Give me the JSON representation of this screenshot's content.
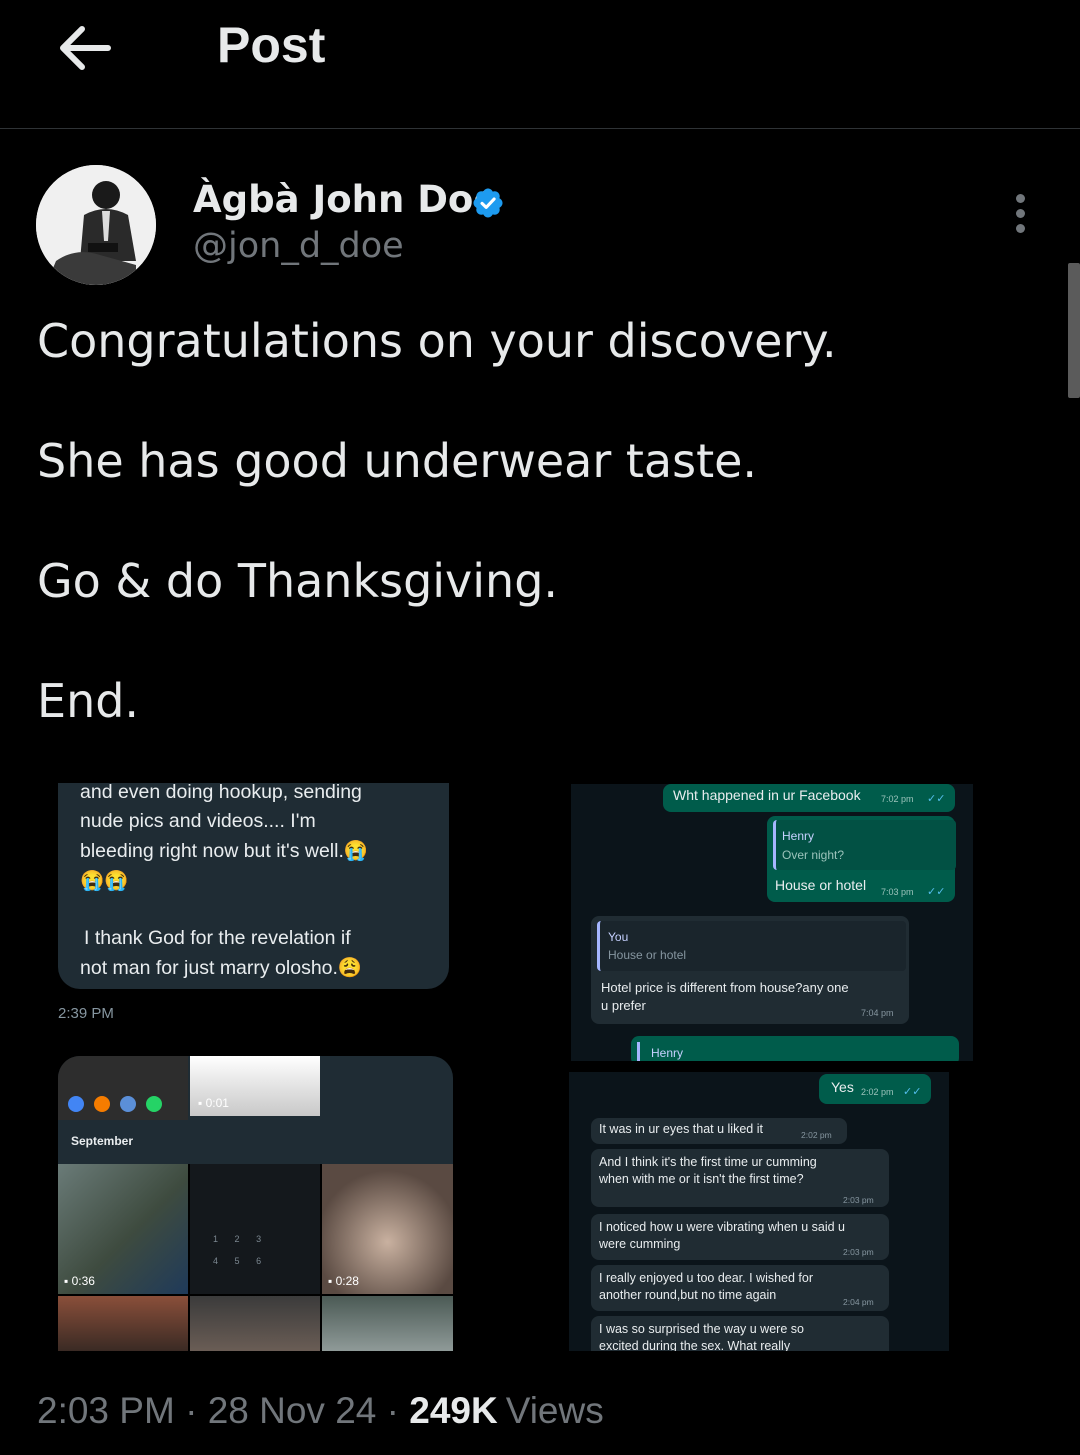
{
  "header": {
    "title": "Post"
  },
  "author": {
    "display_name": "Àgbà John Doe",
    "handle": "@jon_d_doe",
    "verified": true
  },
  "tweet": {
    "lines": [
      "Congratulations on your discovery.",
      "She has good underwear taste.",
      "Go & do Thanksgiving.",
      "End."
    ]
  },
  "media": {
    "shot1": {
      "lines": [
        "and even doing hookup, sending",
        "nude pics and videos.... I'm",
        "bleeding right now but it's well.😭",
        "😭😭",
        "I thank God for the revelation if",
        "not man for just marry olosho.😩"
      ],
      "time": "2:39 PM"
    },
    "shot2": {
      "msg1": "Wht happened in ur Facebook",
      "msg1_time": "7:02 pm",
      "quote1_name": "Henry",
      "quote1_text": "Over night?",
      "msg2": "House or hotel",
      "msg2_time": "7:03 pm",
      "quote2_name": "You",
      "quote2_text": "House or hotel",
      "msg3_line1": "Hotel price is different from house?any one",
      "msg3_line2": "u prefer",
      "msg3_time": "7:04 pm",
      "quote3_name": "Henry"
    },
    "shot3": {
      "video_top": "0:01",
      "month": "September",
      "keypad": [
        "1",
        "2",
        "3",
        "4",
        "5",
        "6"
      ],
      "video_left": "0:36",
      "video_right": "0:28"
    },
    "shot4": {
      "yes": "Yes",
      "yes_time": "2:02 pm",
      "m1": "It was in ur eyes that u liked it",
      "m1_time": "2:02 pm",
      "m2_line1": "And I think it's the first time ur cumming",
      "m2_line2": "when with me or it isn't the first time?",
      "m2_time": "2:03 pm",
      "m3_line1": "I noticed how u were vibrating when u said u",
      "m3_line2": "were cumming",
      "m3_time": "2:03 pm",
      "m4_line1": "I really enjoyed u too dear. I wished for",
      "m4_line2": "another round,but no time again",
      "m4_time": "2:04 pm",
      "m5_line1": "I was so surprised the way u were so",
      "m5_line2": "excited during the sex. What really"
    }
  },
  "meta": {
    "time": "2:03 PM",
    "date": "28 Nov 24",
    "separator": "·",
    "views_count": "249K",
    "views_label": "Views"
  },
  "colors": {
    "background": "#000000",
    "text_primary": "#e7e9ea",
    "text_secondary": "#71767b",
    "verified_blue": "#1d9bf0",
    "wa_outgoing": "#005c4b",
    "wa_incoming": "#202c33"
  }
}
